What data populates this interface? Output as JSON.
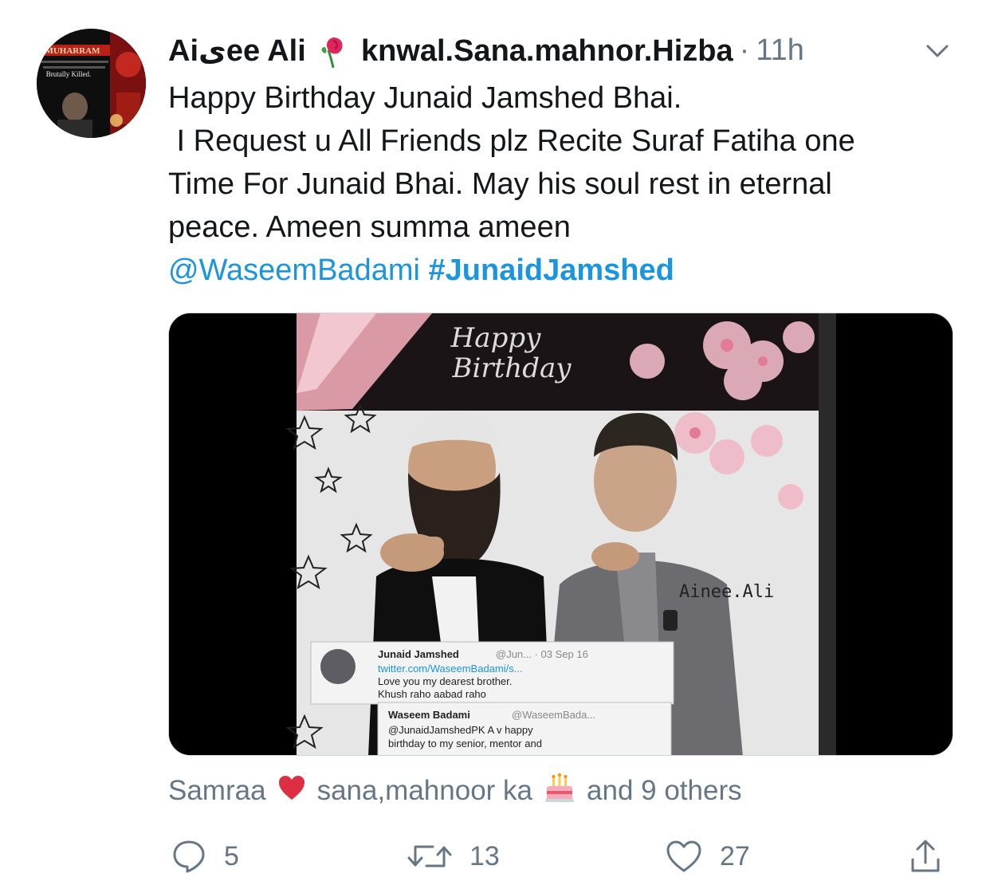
{
  "tweet": {
    "author_name": "Aiیee Ali",
    "author_name_rest": "knwal.Sana.mahnor.Hizba",
    "dot": "·",
    "time": "11h",
    "lines": [
      "Happy Birthday Junaid Jamshed Bhai.",
      " I Request u All Friends plz Recite Suraf Fatiha one",
      "Time For Junaid Bhai. May his soul rest in eternal",
      "peace. Ameen summa ameen"
    ],
    "mention": "@WaseemBadami",
    "hashtag": "#JunaidJamshed"
  },
  "avatar": {
    "title_text": "MUHARRAM",
    "caption": "Brutally Killed."
  },
  "media": {
    "greeting_line1": "Happy",
    "greeting_line2": "Birthday",
    "watermark": "Ainee.Ali",
    "card1_name": "Junaid Jamshed",
    "card1_handle": "@Jun... · 03 Sep 16",
    "card1_link": "twitter.com/WaseemBadami/s...",
    "card1_line1": "Love you my dearest brother.",
    "card1_line2": "Khush raho aabad raho",
    "card2_name": "Waseem Badami",
    "card2_handle": "@WaseemBada...",
    "card2_line1": "@JunaidJamshedPK A v happy",
    "card2_line2": "birthday to my senior,  mentor and"
  },
  "likers": {
    "first": "Samraa",
    "second": "sana,mahnoor ka",
    "rest": "and 9 others"
  },
  "actions": {
    "replies": "5",
    "retweets": "13",
    "likes": "27"
  },
  "colors": {
    "link": "#1b95e0",
    "heart": "#e0245e",
    "secondary_text": "#657786"
  }
}
